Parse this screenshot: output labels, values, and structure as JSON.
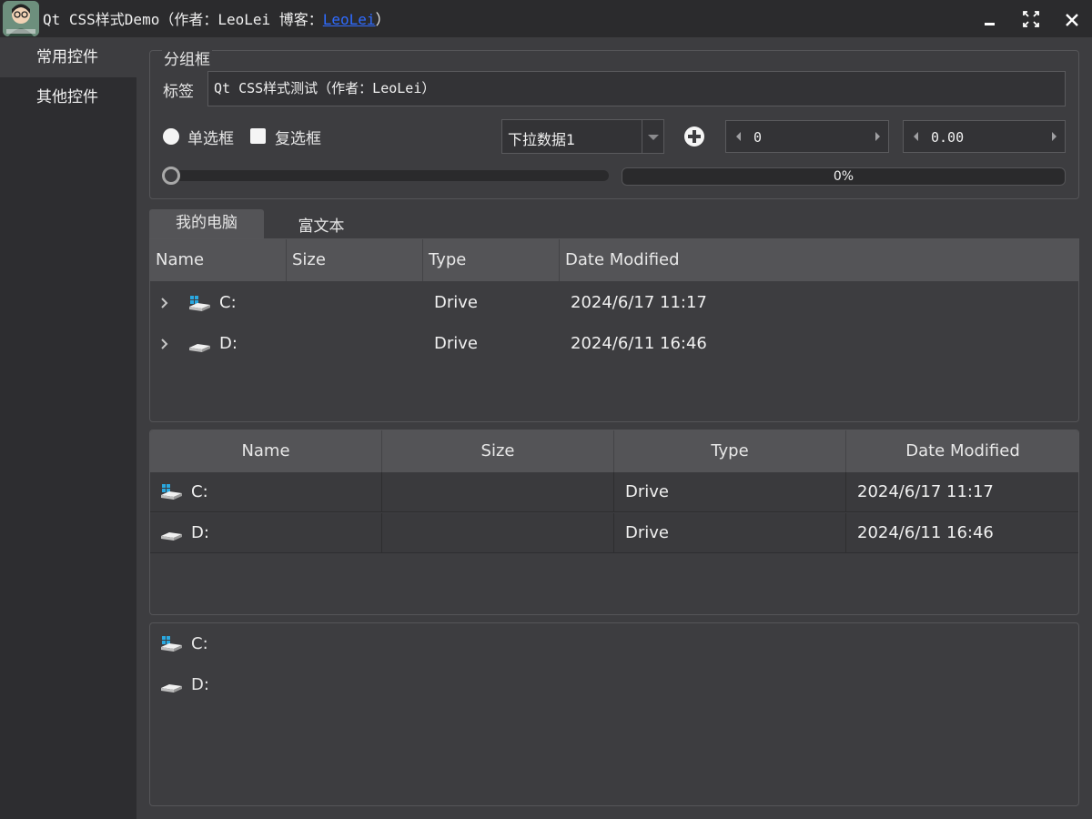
{
  "window": {
    "title_prefix": "Qt CSS样式Demo（作者：LeoLei 博客：",
    "title_link": "LeoLei",
    "title_suffix": "）"
  },
  "sidebar": {
    "items": [
      {
        "label": "常用控件",
        "active": true
      },
      {
        "label": "其他控件",
        "active": false
      }
    ]
  },
  "groupbox": {
    "title": "分组框",
    "label": "标签",
    "line_edit_value": "Qt CSS样式测试（作者：LeoLei）",
    "radio_label": "单选框",
    "checkbox_label": "复选框",
    "combo_value": "下拉数据1",
    "spin_int_value": "0",
    "spin_double_value": "0.00",
    "progress_text": "0%",
    "progress_value": 0,
    "slider_value": 0
  },
  "tabs": [
    {
      "label": "我的电脑",
      "active": true
    },
    {
      "label": "富文本",
      "active": false
    }
  ],
  "columns": [
    "Name",
    "Size",
    "Type",
    "Date Modified"
  ],
  "drives": [
    {
      "name": "C:",
      "size": "",
      "type": "Drive",
      "date": "2024/6/17 11:17",
      "icon": "system-drive-icon"
    },
    {
      "name": "D:",
      "size": "",
      "type": "Drive",
      "date": "2024/6/11 16:46",
      "icon": "drive-icon"
    }
  ],
  "colors": {
    "background": "#3d3d40",
    "sidebar": "#2d2d30",
    "header": "#545457",
    "link": "#2f6bff",
    "windows_logo": "#2aa8e0"
  }
}
